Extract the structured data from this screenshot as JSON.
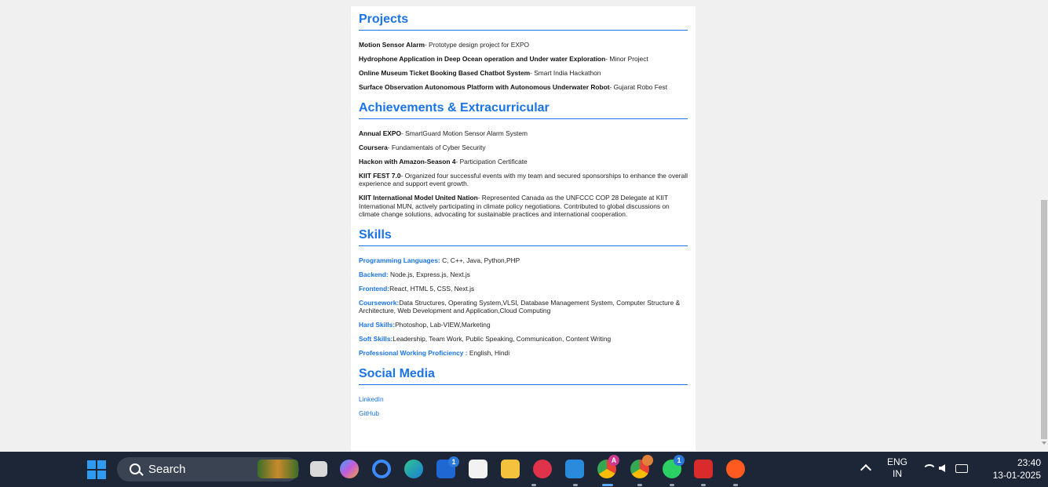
{
  "projects": {
    "title": "Projects",
    "items": [
      {
        "name": "Motion Sensor Alarm",
        "desc": "- Prototype design project for EXPO"
      },
      {
        "name": "Hydrophone Application in Deep Ocean operation and Under water Exploration",
        "desc": "- Minor Project"
      },
      {
        "name": "Online Museum Ticket Booking Based Chatbot System",
        "desc": "- Smart India Hackathon"
      },
      {
        "name": "Surface Observation Autonomous Platform with Autonomous Underwater Robot",
        "desc": "- Gujarat Robo Fest"
      }
    ]
  },
  "achievements": {
    "title": "Achievements & Extracurricular",
    "items": [
      {
        "name": "Annual EXPO",
        "desc": "- SmartGuard Motion Sensor Alarm System"
      },
      {
        "name": "Coursera",
        "desc": "- Fundamentals of Cyber Security"
      },
      {
        "name": "Hackon with Amazon-Season 4",
        "desc": "- Participation Certificate"
      },
      {
        "name": "KIIT FEST 7.0",
        "desc": "- Organized four successful events with my team and secured sponsorships to enhance the overall experience and support event growth."
      },
      {
        "name": "KIIT International Model United Nation",
        "desc": "- Represented Canada as the UNFCCC COP 28 Delegate at KIIT International MUN, actively participating in climate policy negotiations. Contributed to global discussions on climate change solutions, advocating for sustainable practices and international cooperation."
      }
    ]
  },
  "skills": {
    "title": "Skills",
    "items": [
      {
        "key": "Programming Languages:",
        "value": " C, C++, Java, Python,PHP"
      },
      {
        "key": "Backend:",
        "value": " Node.js, Express.js, Next.js"
      },
      {
        "key": "Frontend:",
        "value": "React, HTML 5, CSS, Next.js"
      },
      {
        "key": "Coursework:",
        "value": "Data Structures, Operating System,VLSI, Database Management System, Computer Structure & Architecture, Web Development and Application,Cloud Computing"
      },
      {
        "key": "Hard Skills:",
        "value": "Photoshop, Lab-VIEW,Marketing"
      },
      {
        "key": "Soft Skills:",
        "value": "Leadership, Team Work, Public Speaking, Communication, Content Writing"
      },
      {
        "key": "Professional Working Proficiency :",
        "value": " English, Hindi"
      }
    ]
  },
  "social": {
    "title": "Social Media",
    "links": [
      "LinkedIn",
      "GitHub"
    ]
  },
  "taskbar": {
    "search_label": "Search",
    "badges": {
      "copilot": "1",
      "whatsapp": "1",
      "chrome_a": "A"
    },
    "lang_line1": "ENG",
    "lang_line2": "IN",
    "time": "23:40",
    "date": "13-01-2025"
  },
  "colors": {
    "accent": "#1a73e8",
    "taskbar": "#1c2636"
  }
}
